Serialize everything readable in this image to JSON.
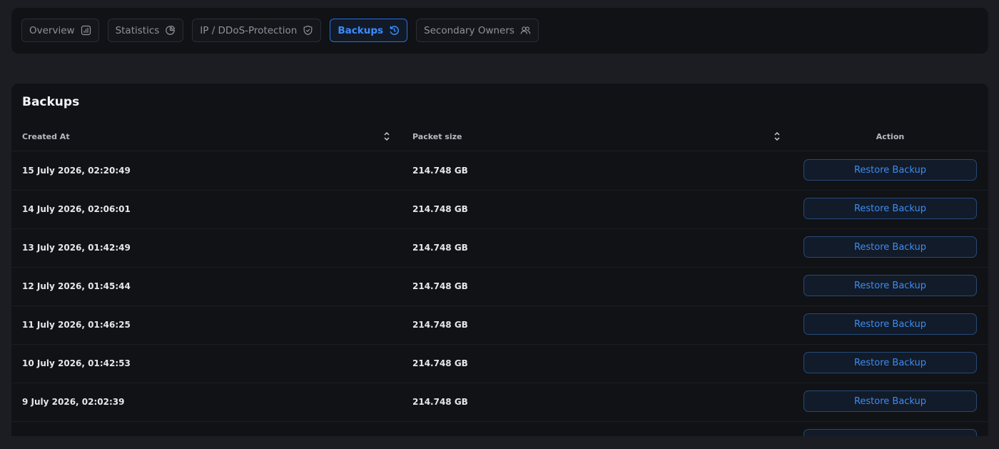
{
  "tabs": [
    {
      "label": "Overview",
      "icon": "bar-chart-icon",
      "active": false
    },
    {
      "label": "Statistics",
      "icon": "pie-chart-icon",
      "active": false
    },
    {
      "label": "IP / DDoS-Protection",
      "icon": "shield-icon",
      "active": false
    },
    {
      "label": "Backups",
      "icon": "restore-history-icon",
      "active": true
    },
    {
      "label": "Secondary Owners",
      "icon": "users-icon",
      "active": false
    }
  ],
  "backups": {
    "title": "Backups",
    "columns": {
      "created_at": "Created At",
      "packet_size": "Packet size",
      "action": "Action"
    },
    "rows": [
      {
        "created_at": "15 July 2026, 02:20:49",
        "size": "214.748 GB",
        "action": "Restore Backup"
      },
      {
        "created_at": "14 July 2026, 02:06:01",
        "size": "214.748 GB",
        "action": "Restore Backup"
      },
      {
        "created_at": "13 July 2026, 01:42:49",
        "size": "214.748 GB",
        "action": "Restore Backup"
      },
      {
        "created_at": "12 July 2026, 01:45:44",
        "size": "214.748 GB",
        "action": "Restore Backup"
      },
      {
        "created_at": "11 July 2026, 01:46:25",
        "size": "214.748 GB",
        "action": "Restore Backup"
      },
      {
        "created_at": "10 July 2026, 01:42:53",
        "size": "214.748 GB",
        "action": "Restore Backup"
      },
      {
        "created_at": "9 July 2026, 02:02:39",
        "size": "214.748 GB",
        "action": "Restore Backup"
      },
      {
        "created_at": "",
        "size": "",
        "action": ""
      }
    ]
  },
  "colors": {
    "accent": "#3b8cff",
    "panel": "#101216",
    "background": "#1b1d22"
  }
}
